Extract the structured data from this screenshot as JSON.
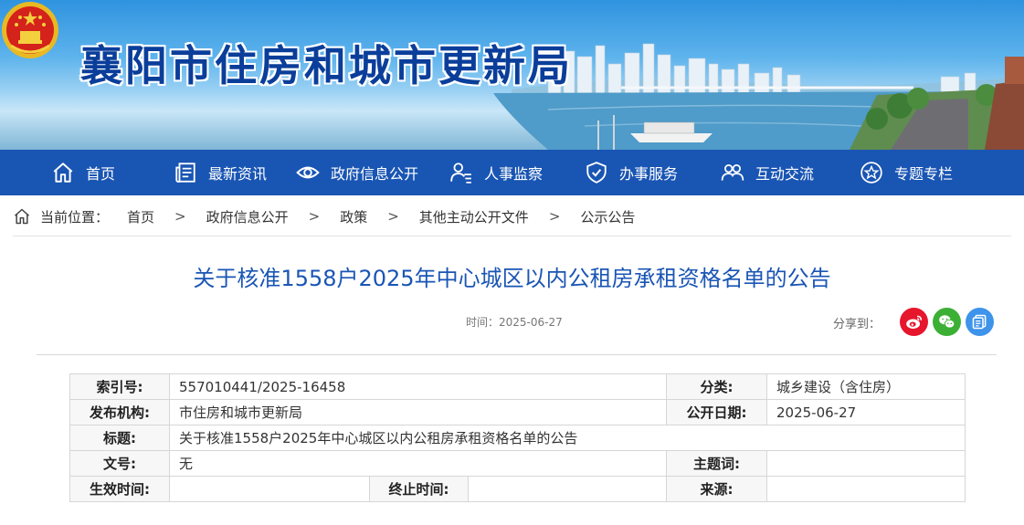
{
  "site": {
    "title": "襄阳市住房和城市更新局",
    "emblem_icon": "national-emblem-icon"
  },
  "nav": {
    "items": [
      {
        "label": "首页",
        "icon": "home-icon"
      },
      {
        "label": "最新资讯",
        "icon": "news-icon"
      },
      {
        "label": "政府信息公开",
        "icon": "eye-icon"
      },
      {
        "label": "人事监察",
        "icon": "person-list-icon"
      },
      {
        "label": "办事服务",
        "icon": "shield-check-icon"
      },
      {
        "label": "互动交流",
        "icon": "people-chat-icon"
      },
      {
        "label": "专题专栏",
        "icon": "star-circle-icon"
      }
    ]
  },
  "breadcrumb": {
    "label": "当前位置：",
    "separator": ">",
    "items": [
      "首页",
      "政府信息公开",
      "政策",
      "其他主动公开文件",
      "公示公告"
    ]
  },
  "article": {
    "title": "关于核准1558户2025年中心城区以内公租房承租资格名单的公告",
    "time": "时间：2025-06-27",
    "share_label": "分享到："
  },
  "share": {
    "buttons": [
      {
        "icon": "weibo-icon",
        "color": "#e6162d"
      },
      {
        "icon": "wechat-icon",
        "color": "#3cb035"
      },
      {
        "icon": "qzone-icon",
        "color": "#3e93ea"
      }
    ]
  },
  "meta_table": {
    "index_label": "索引号:",
    "index_value": "557010441/2025-16458",
    "category_label": "分类:",
    "category_value": "城乡建设（含住房）",
    "publisher_label": "发布机构:",
    "publisher_value": "市住房和城市更新局",
    "pubdate_label": "公开日期:",
    "pubdate_value": "2025-06-27",
    "title_label": "标题:",
    "title_value": "关于核准1558户2025年中心城区以内公租房承租资格名单的公告",
    "docno_label": "文号:",
    "docno_value": "无",
    "keywords_label": "主题词:",
    "keywords_value": "",
    "effective_label": "生效时间:",
    "effective_value": "",
    "end_label": "终止时间:",
    "end_value": "",
    "source_label": "来源:",
    "source_value": ""
  },
  "colors": {
    "nav_bg": "#1955b3",
    "title_blue": "#1a55b5",
    "site_title": "#0a3e9a"
  }
}
